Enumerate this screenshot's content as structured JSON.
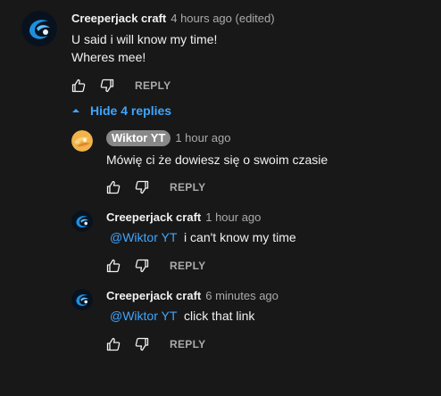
{
  "colors": {
    "background": "#181818",
    "text": "#f1f1f1",
    "muted": "#aaaaaa",
    "link": "#3ea6ff",
    "chip": "#888888"
  },
  "top_comment": {
    "author": "Creeperjack craft",
    "time": "4 hours ago (edited)",
    "lines": [
      "U said i will know my time!",
      "Wheres mee!"
    ],
    "avatar_icon": "creeper-logo-avatar",
    "reply_label": "REPLY"
  },
  "replies_toggle": {
    "label": "Hide 4 replies",
    "icon": "caret-up-icon"
  },
  "replies": [
    {
      "author": "Wiktor YT",
      "author_is_owner_chip": true,
      "time": "1 hour ago",
      "mention": "",
      "text": "Mówię ci że dowiesz się o swoim czasie",
      "avatar_icon": "orange-swirl-avatar",
      "reply_label": "REPLY"
    },
    {
      "author": "Creeperjack craft",
      "author_is_owner_chip": false,
      "time": "1 hour ago",
      "mention": "@Wiktor YT",
      "text": "i can't know my time",
      "avatar_icon": "creeper-logo-avatar",
      "reply_label": "REPLY"
    },
    {
      "author": "Creeperjack craft",
      "author_is_owner_chip": false,
      "time": "6 minutes ago",
      "mention": "@Wiktor YT",
      "text": "click that link",
      "avatar_icon": "creeper-logo-avatar",
      "reply_label": "REPLY"
    }
  ]
}
